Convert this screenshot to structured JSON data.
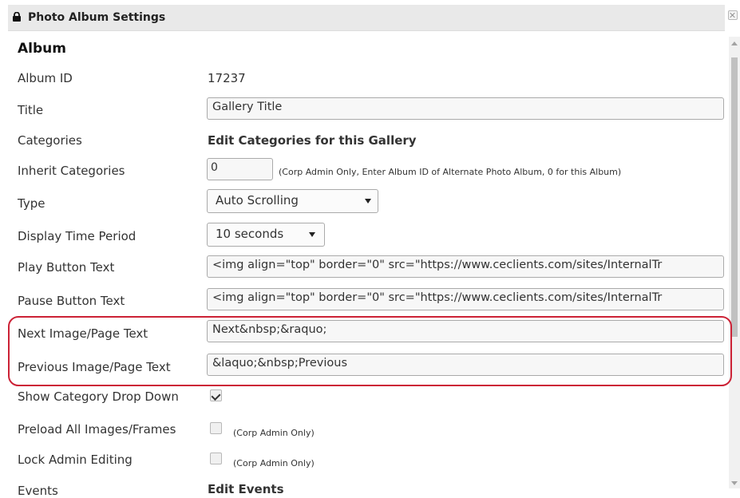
{
  "dialog": {
    "title": "Photo Album Settings",
    "lock_icon": "lock-icon",
    "close_icon": "close-icon"
  },
  "section": {
    "heading": "Album"
  },
  "fields": {
    "album_id": {
      "label": "Album ID",
      "value": "17237"
    },
    "title": {
      "label": "Title",
      "value": "Gallery Title"
    },
    "categories": {
      "label": "Categories",
      "link": "Edit Categories for this Gallery"
    },
    "inherit_categories": {
      "label": "Inherit Categories",
      "value": "0",
      "hint": "(Corp Admin Only, Enter Album ID of Alternate Photo Album, 0 for this Album)"
    },
    "type": {
      "label": "Type",
      "selected": "Auto Scrolling"
    },
    "display_time_period": {
      "label": "Display Time Period",
      "selected": "10 seconds"
    },
    "play_button_text": {
      "label": "Play Button Text",
      "value": "<img align=\"top\" border=\"0\" src=\"https://www.ceclients.com/sites/InternalTr"
    },
    "pause_button_text": {
      "label": "Pause Button Text",
      "value": "<img align=\"top\" border=\"0\" src=\"https://www.ceclients.com/sites/InternalTr"
    },
    "next_image_page_text": {
      "label": "Next Image/Page Text",
      "value": "Next&nbsp;&raquo;"
    },
    "previous_image_page_text": {
      "label": "Previous Image/Page Text",
      "value": "&laquo;&nbsp;Previous"
    },
    "show_category_drop_down": {
      "label": "Show Category Drop Down",
      "checked": true
    },
    "preload_all_images_frames": {
      "label": "Preload All Images/Frames",
      "checked": false,
      "hint": "(Corp Admin Only)"
    },
    "lock_admin_editing": {
      "label": "Lock Admin Editing",
      "checked": false,
      "hint": "(Corp Admin Only)"
    },
    "events": {
      "label": "Events",
      "link": "Edit Events"
    }
  },
  "highlight": {
    "color": "#cc2236"
  }
}
